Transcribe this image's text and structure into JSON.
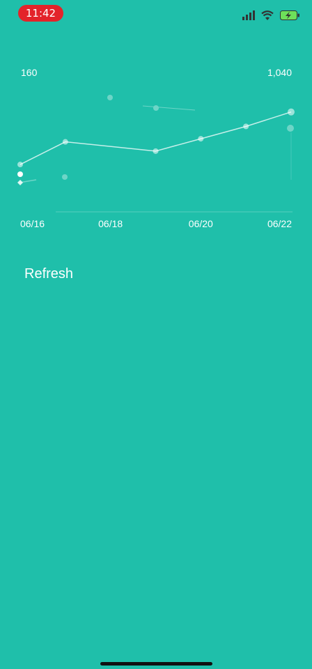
{
  "status_bar": {
    "time": "11:42"
  },
  "chart_data": {
    "type": "line",
    "y_min_label": "160",
    "y_max_label": "1,040",
    "x_tick_labels": [
      "06/16",
      "06/18",
      "06/20",
      "06/22"
    ],
    "ylim": [
      160,
      1040
    ],
    "series": [
      {
        "x": [
          "06/16",
          "06/17",
          "06/19",
          "06/20",
          "06/21",
          "06/22"
        ],
        "values": [
          390,
          610,
          520,
          640,
          760,
          900
        ]
      }
    ]
  },
  "actions": {
    "refresh_label": "Refresh"
  }
}
